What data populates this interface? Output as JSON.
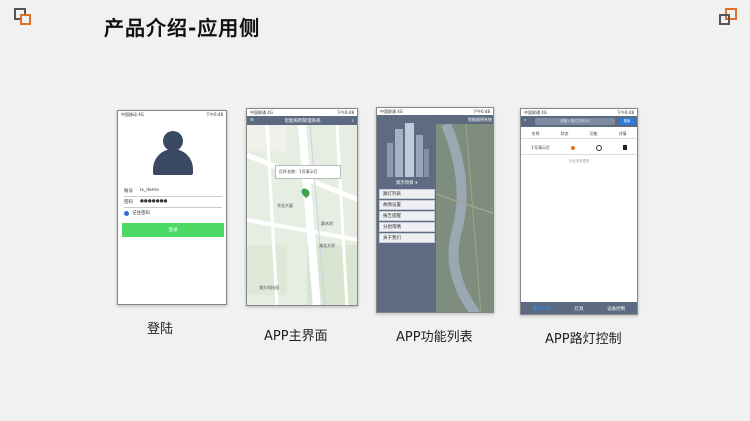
{
  "title": "产品介绍-应用侧",
  "colors": {
    "accent": "#e0702a",
    "nav": "#5b6a80",
    "login_button": "#4cd964"
  },
  "screens": [
    {
      "caption": "登陆",
      "status": {
        "carrier": "中国移动 4G",
        "time": "下午6:48"
      },
      "account_label": "账号",
      "account_value": "lx_demo",
      "password_label": "密码",
      "password_value": "●●●●●●●",
      "remember_label": "记住密码",
      "login_button": "登录"
    },
    {
      "caption": "APP主界面",
      "status": {
        "carrier": "中国联通 4G",
        "time": "下午6:48"
      },
      "header_title": "智能照明管理系统",
      "popup_text": "灯杆名称：1号演示灯",
      "map_labels": [
        "华业大厦",
        "赛木桥",
        "湖北大学",
        "湖大科技园"
      ]
    },
    {
      "caption": "APP功能列表",
      "status": {
        "carrier": "中国联通 4G",
        "time": "下午6:48"
      },
      "project": "演示项目 ▾",
      "header_title": "智能照明系统",
      "menu_items": [
        "路灯列表",
        "故障设置",
        "报告提醒",
        "分组策略",
        "关于我们"
      ]
    },
    {
      "caption": "APP路灯控制",
      "status": {
        "carrier": "中国联通 4G",
        "time": "下午6:48"
      },
      "search_placeholder": "请输入路灯名称/ID",
      "search_button": "搜索",
      "columns": [
        "名称",
        "状态",
        "功能",
        "详情"
      ],
      "row": {
        "name": "1号演示灯"
      },
      "empty_text": "已经没有更多",
      "tabs": [
        "路灯列表",
        "灯具",
        "设备控制"
      ]
    }
  ]
}
